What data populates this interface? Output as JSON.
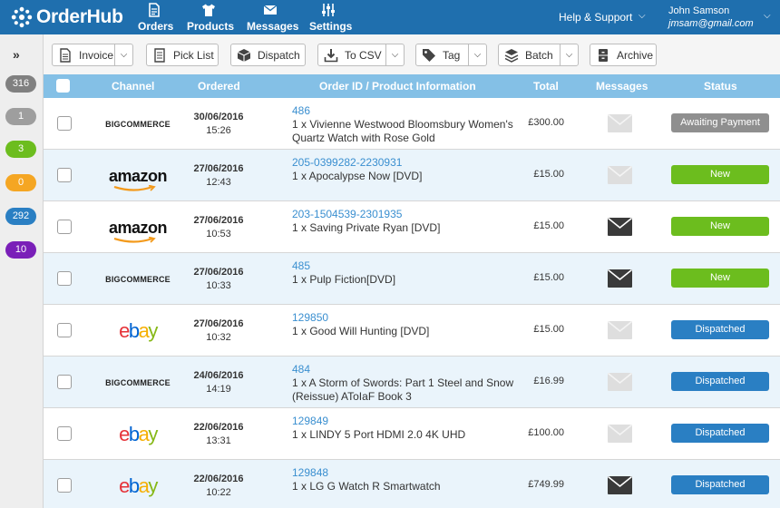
{
  "app": {
    "logo_text": "OrderHub"
  },
  "nav": {
    "items": [
      {
        "label": "Orders",
        "icon": "document-icon"
      },
      {
        "label": "Products",
        "icon": "tshirt-icon"
      },
      {
        "label": "Messages",
        "icon": "envelope-icon"
      },
      {
        "label": "Settings",
        "icon": "sliders-icon"
      }
    ],
    "help_label": "Help & Support",
    "user_name": "John Samson",
    "user_email": "jmsam@gmail.com"
  },
  "sidebar": {
    "expand_icon": "double-chevron-right-icon",
    "counts": [
      {
        "value": "316",
        "color": "#808080"
      },
      {
        "value": "1",
        "color": "#9e9e9e"
      },
      {
        "value": "3",
        "color": "#6cbd1e"
      },
      {
        "value": "0",
        "color": "#f5a623"
      },
      {
        "value": "292",
        "color": "#2a7fc3"
      },
      {
        "value": "10",
        "color": "#7a1fb8"
      }
    ]
  },
  "toolbar": {
    "invoice_label": "Invoice",
    "picklist_label": "Pick List",
    "dispatch_label": "Dispatch",
    "tocsv_label": "To CSV",
    "tag_label": "Tag",
    "batch_label": "Batch",
    "archive_label": "Archive"
  },
  "table": {
    "headers": {
      "channel": "Channel",
      "ordered": "Ordered",
      "info": "Order ID / Product Information",
      "total": "Total",
      "messages": "Messages",
      "status": "Status"
    },
    "rows": [
      {
        "channel": "bigcommerce",
        "channel_text": "BIGCOMMERCE",
        "date": "30/06/2016",
        "time": "15:26",
        "order_id": "486",
        "product": "1 x Vivienne Westwood Bloomsbury Women's Quartz Watch with Rose Gold",
        "total": "£300.00",
        "has_message": false,
        "status": "Awaiting Payment",
        "status_color": "#8f8f8f"
      },
      {
        "channel": "amazon",
        "channel_text": "amazon",
        "date": "27/06/2016",
        "time": "12:43",
        "order_id": "205-0399282-2230931",
        "product": "1 x Apocalypse Now [DVD]",
        "total": "£15.00",
        "has_message": false,
        "status": "New",
        "status_color": "#6cbd1e"
      },
      {
        "channel": "amazon",
        "channel_text": "amazon",
        "date": "27/06/2016",
        "time": "10:53",
        "order_id": "203-1504539-2301935",
        "product": "1 x Saving Private Ryan [DVD]",
        "total": "£15.00",
        "has_message": true,
        "status": "New",
        "status_color": "#6cbd1e"
      },
      {
        "channel": "bigcommerce",
        "channel_text": "BIGCOMMERCE",
        "date": "27/06/2016",
        "time": "10:33",
        "order_id": "485",
        "product": "1 x Pulp Fiction[DVD]",
        "total": "£15.00",
        "has_message": true,
        "status": "New",
        "status_color": "#6cbd1e"
      },
      {
        "channel": "ebay",
        "channel_text": "ebay",
        "date": "27/06/2016",
        "time": "10:32",
        "order_id": "129850",
        "product": "1 x Good Will Hunting [DVD]",
        "total": "£15.00",
        "has_message": false,
        "status": "Dispatched",
        "status_color": "#2a7fc3"
      },
      {
        "channel": "bigcommerce",
        "channel_text": "BIGCOMMERCE",
        "date": "24/06/2016",
        "time": "14:19",
        "order_id": "484",
        "product": "1 x A Storm of Swords: Part 1 Steel and Snow (Reissue) AToIaF Book 3",
        "total": "£16.99",
        "has_message": false,
        "status": "Dispatched",
        "status_color": "#2a7fc3"
      },
      {
        "channel": "ebay",
        "channel_text": "ebay",
        "date": "22/06/2016",
        "time": "13:31",
        "order_id": "129849",
        "product": "1 x LINDY 5 Port HDMI 2.0 4K UHD",
        "total": "£100.00",
        "has_message": false,
        "status": "Dispatched",
        "status_color": "#2a7fc3"
      },
      {
        "channel": "ebay",
        "channel_text": "ebay",
        "date": "22/06/2016",
        "time": "10:22",
        "order_id": "129848",
        "product": "1 x LG G Watch R Smartwatch",
        "total": "£749.99",
        "has_message": true,
        "status": "Dispatched",
        "status_color": "#2a7fc3"
      }
    ]
  }
}
